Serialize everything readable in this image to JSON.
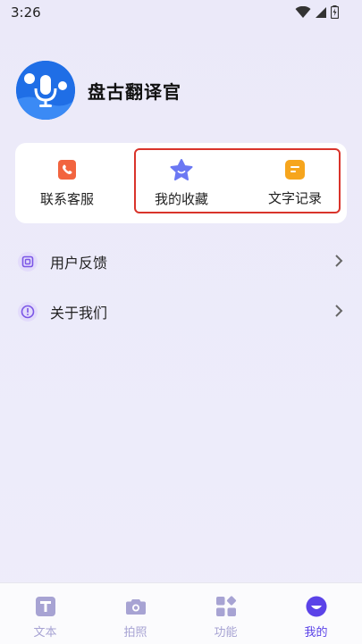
{
  "status": {
    "time": "3:26"
  },
  "profile": {
    "app_name": "盘古翻译官"
  },
  "quick_actions": {
    "contact_label": "联系客服",
    "favorites_label": "我的收藏",
    "text_record_label": "文字记录"
  },
  "menu": {
    "items": [
      {
        "label": "用户反馈"
      },
      {
        "label": "关于我们"
      }
    ]
  },
  "tabbar": {
    "tabs": [
      {
        "label": "文本"
      },
      {
        "label": "拍照"
      },
      {
        "label": "功能"
      },
      {
        "label": "我的"
      }
    ],
    "active": "我的"
  },
  "colors": {
    "accent": "#5b43e8",
    "inactive": "#a7a3d3",
    "highlight": "#d9342b",
    "contact_icon": "#f2643f",
    "favorites_icon": "#6b78f3",
    "record_icon": "#f6a51d"
  }
}
